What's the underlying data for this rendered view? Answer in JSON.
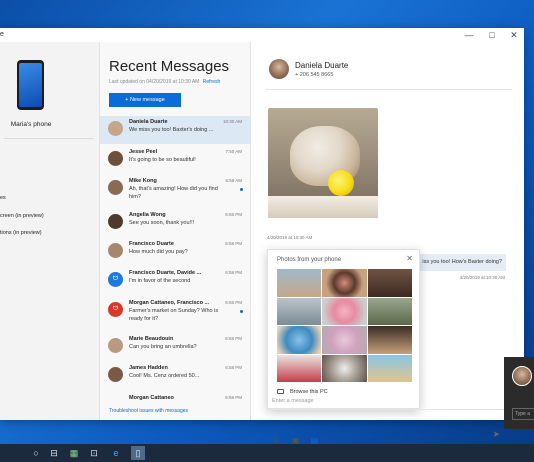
{
  "window": {
    "title_fragment": "e",
    "controls": [
      "—",
      "□",
      "✕"
    ]
  },
  "left_pane": {
    "phone_name": "Maria's phone",
    "nav_items": [
      {
        "label": "es"
      },
      {
        "label": "creen (in preview)"
      },
      {
        "label": "tions (in preview)"
      }
    ]
  },
  "messages": {
    "title": "Recent Messages",
    "updated": "Last updated on 04/20/2019 at 10:30 AM",
    "refresh": "Refresh",
    "new_message": "+ New message",
    "troubleshoot": "Troubleshoot issues with messages",
    "conversations": [
      {
        "name": "Daniela Duarte",
        "time": "10:30 AM",
        "preview": "We miss you too! Baxter's doing ...",
        "unread": false,
        "active": true
      },
      {
        "name": "Jesse Peel",
        "time": "7:50 AM",
        "preview": "It's going to be so beautiful!",
        "unread": false,
        "active": false
      },
      {
        "name": "Mike Kong",
        "time": "6:58 AM",
        "preview": "Ah, that's amazing! How did you find him?",
        "unread": true,
        "active": false
      },
      {
        "name": "Angelia Wong",
        "time": "6:58 PM",
        "preview": "See you soon, thank you!!!",
        "unread": false,
        "active": false
      },
      {
        "name": "Francisco Duarte",
        "time": "6:58 PM",
        "preview": "How much did you pay?",
        "unread": false,
        "active": false
      },
      {
        "name": "Francisco Duarte, Davide ...",
        "time": "6:58 PM",
        "preview": "I'm in favor of the second",
        "unread": false,
        "active": false,
        "avatar_text": "ᗢ"
      },
      {
        "name": "Morgan Cattaneo, Francisco ...",
        "time": "6:58 PM",
        "preview": "Farmer's market on Sunday? Who is ready for it?",
        "unread": true,
        "active": false,
        "avatar_text": "ᗢ"
      },
      {
        "name": "Marie Beaudouin",
        "time": "6:58 PM",
        "preview": "Can you bring an umbrella?",
        "unread": false,
        "active": false
      },
      {
        "name": "James Hadden",
        "time": "6:58 PM",
        "preview": "Cool! Ms. Cenz ordered 50...",
        "unread": false,
        "active": false
      },
      {
        "name": "Morgan Cattaneo",
        "time": "6:58 PM",
        "preview": "",
        "unread": false,
        "active": false
      }
    ]
  },
  "chat": {
    "contact_name": "Daniela Duarte",
    "contact_phone": "+ 206 545 8665",
    "photo_time": "4/20/2019 at 10:30 AM",
    "bubble_text": "iss you too! How's Baxter doing?",
    "bubble_time": "4/20/2019 at 10:30 AM",
    "compose_placeholder": "Enter a message",
    "picker": {
      "title": "Photos from your phone",
      "close": "✕",
      "browse": "Browse this PC"
    },
    "compose_icons": [
      "emoji-icon",
      "gif-icon",
      "image-icon"
    ],
    "send_glyph": "➤"
  },
  "toast": {
    "input_placeholder": "Type a"
  },
  "taskbar": {
    "icons": [
      "search-circle-icon",
      "task-view-icon",
      "store-icon",
      "briefcase-icon",
      "edge-icon",
      "your-phone-icon"
    ]
  }
}
